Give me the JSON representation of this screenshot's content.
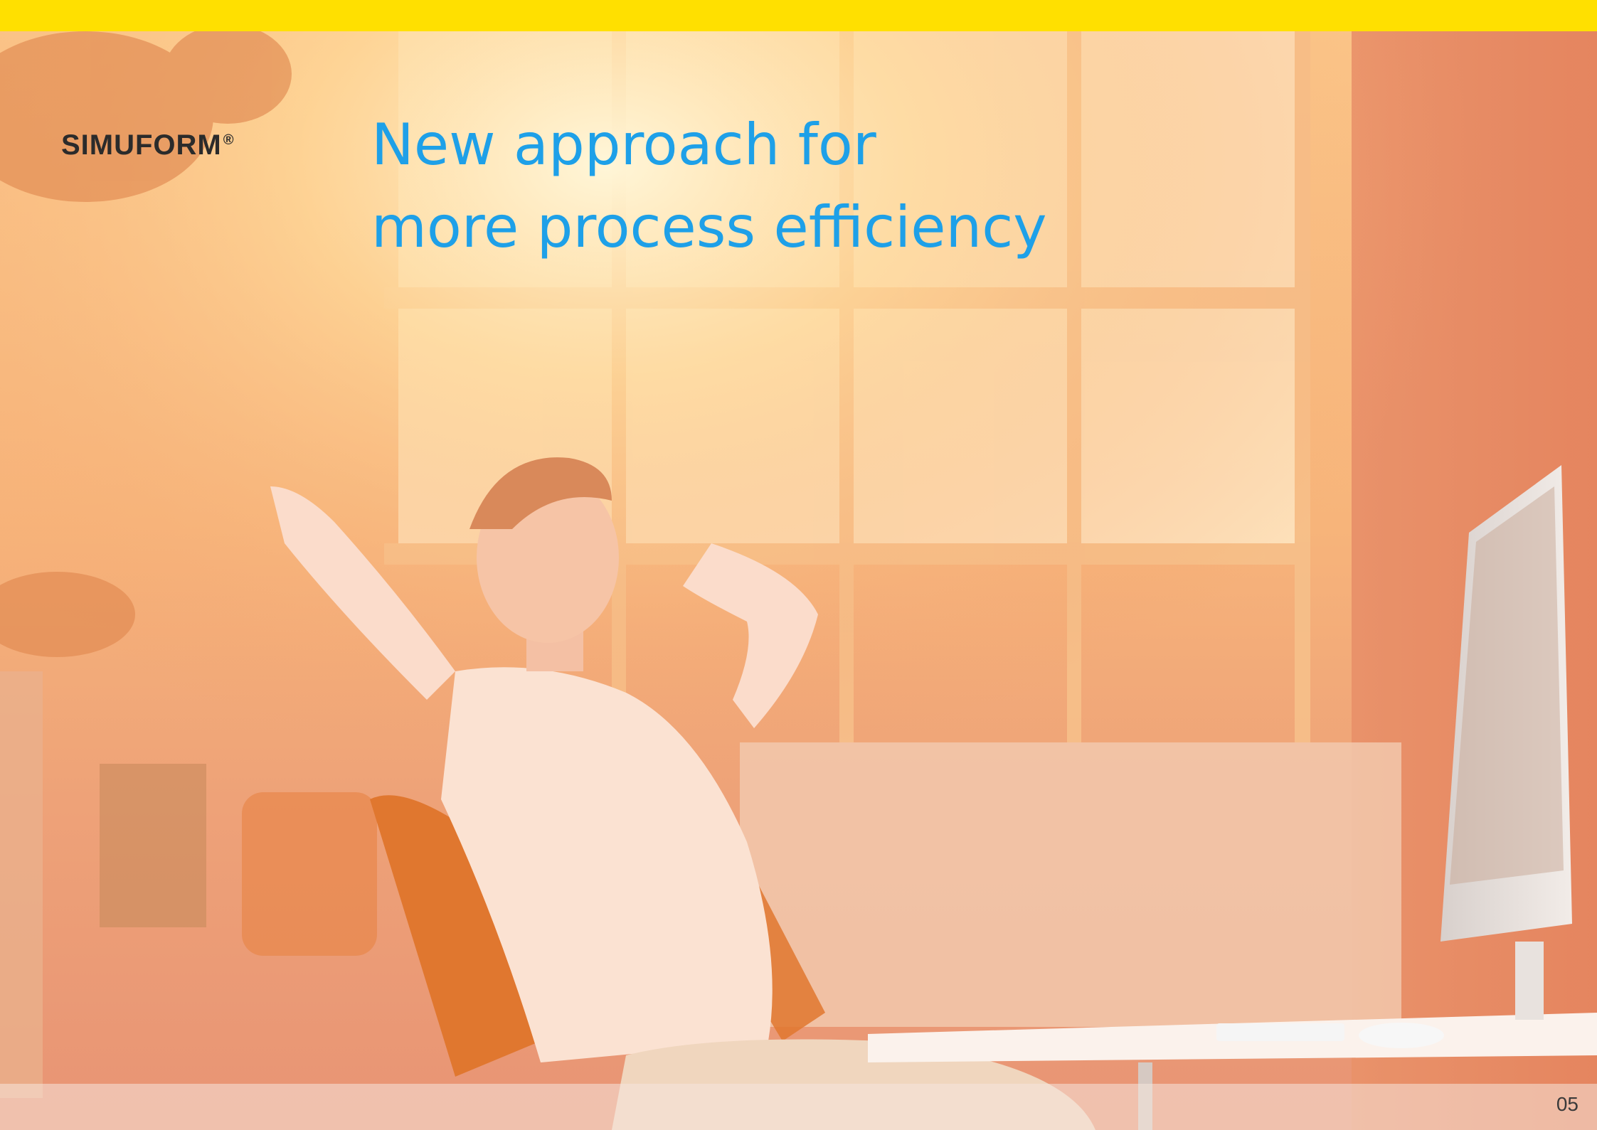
{
  "brand": {
    "logo_text": "SIMUFORM",
    "logo_mark": "®"
  },
  "headline": {
    "line1": "New approach for",
    "line2": "more process efficiency"
  },
  "footer": {
    "page_number": "05"
  },
  "colors": {
    "top_bar": "#ffe000",
    "headline": "#1ea0e8",
    "logo": "#2b2b2b"
  },
  "background_image": {
    "icon": "office-photo-woman-relaxing"
  }
}
